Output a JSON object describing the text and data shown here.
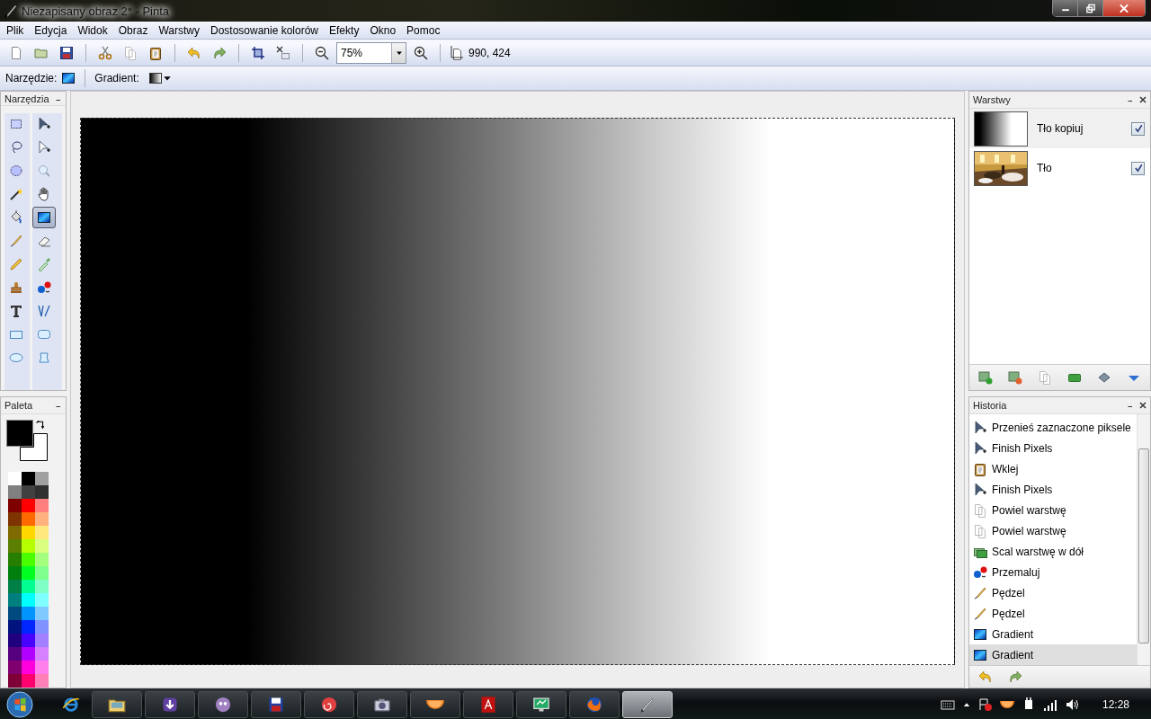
{
  "window": {
    "title": "Niezapisany obraz 2* - Pinta"
  },
  "menu": [
    "Plik",
    "Edycja",
    "Widok",
    "Obraz",
    "Warstwy",
    "Dostosowanie kolorów",
    "Efekty",
    "Okno",
    "Pomoc"
  ],
  "toolbar": {
    "zoom": "75%",
    "coordinates": "990, 424"
  },
  "tool_options": {
    "tool_label": "Narzędzie:",
    "gradient_label": "Gradient:"
  },
  "tools_panel": {
    "title": "Narzędzia",
    "tools": [
      {
        "selected": false
      },
      {
        "selected": false
      },
      {
        "selected": false
      },
      {
        "selected": false
      },
      {
        "selected": false
      },
      {
        "selected": false
      },
      {
        "selected": false
      },
      {
        "selected": false
      },
      {
        "selected": false
      },
      {
        "selected": true
      },
      {
        "selected": false
      },
      {
        "selected": false
      },
      {
        "selected": false
      },
      {
        "selected": false
      },
      {
        "selected": false
      },
      {
        "selected": false
      },
      {
        "selected": false
      },
      {
        "selected": false
      },
      {
        "selected": false
      },
      {
        "selected": false
      },
      {
        "selected": false
      },
      {
        "selected": false
      }
    ]
  },
  "palette_panel": {
    "title": "Paleta",
    "primary": {
      "color": "#000000"
    },
    "secondary": {
      "color": "#ffffff"
    },
    "swatches": [
      {
        "color": "#ffffff"
      },
      {
        "color": "#000000"
      },
      {
        "color": "#a0a0a0"
      },
      {
        "color": "#808080"
      },
      {
        "color": "#404040"
      },
      {
        "color": "#303030"
      },
      {
        "color": "#7f0000"
      },
      {
        "color": "#ff0000"
      },
      {
        "color": "#ff7f7f"
      },
      {
        "color": "#7f3300"
      },
      {
        "color": "#ff6a00"
      },
      {
        "color": "#ffb27f"
      },
      {
        "color": "#7f6a00"
      },
      {
        "color": "#ffd800"
      },
      {
        "color": "#ffe97f"
      },
      {
        "color": "#5b7f00"
      },
      {
        "color": "#b6ff00"
      },
      {
        "color": "#daff7f"
      },
      {
        "color": "#267f00"
      },
      {
        "color": "#4cff00"
      },
      {
        "color": "#a5ff7f"
      },
      {
        "color": "#007f0e"
      },
      {
        "color": "#00ff21"
      },
      {
        "color": "#7fff8e"
      },
      {
        "color": "#007f46"
      },
      {
        "color": "#00ff90"
      },
      {
        "color": "#7fffc5"
      },
      {
        "color": "#007f7f"
      },
      {
        "color": "#00ffff"
      },
      {
        "color": "#7fffff"
      },
      {
        "color": "#004a7f"
      },
      {
        "color": "#0094ff"
      },
      {
        "color": "#7fc9ff"
      },
      {
        "color": "#00137f"
      },
      {
        "color": "#0026ff"
      },
      {
        "color": "#7f92ff"
      },
      {
        "color": "#21007f"
      },
      {
        "color": "#4800ff"
      },
      {
        "color": "#a17fff"
      },
      {
        "color": "#57007f"
      },
      {
        "color": "#b200ff"
      },
      {
        "color": "#d67fff"
      },
      {
        "color": "#7f006e"
      },
      {
        "color": "#ff00dc"
      },
      {
        "color": "#ff7fed"
      },
      {
        "color": "#7f0037"
      },
      {
        "color": "#ff006e"
      },
      {
        "color": "#ff7fb6"
      }
    ]
  },
  "layers_panel": {
    "title": "Warstwy",
    "layers": [
      {
        "name": "Tło kopiuj",
        "visible": true,
        "selected": true,
        "kind": "gradient"
      },
      {
        "name": "Tło",
        "visible": true,
        "selected": false,
        "kind": "picture"
      }
    ]
  },
  "history_panel": {
    "title": "Historia",
    "items": [
      {
        "label": "Przenieś zaznaczone piksele",
        "kind": "move",
        "selected": false
      },
      {
        "label": "Finish Pixels",
        "kind": "move",
        "selected": false
      },
      {
        "label": "Wklej",
        "kind": "paste",
        "selected": false
      },
      {
        "label": "Finish Pixels",
        "kind": "move",
        "selected": false
      },
      {
        "label": "Powiel warstwę",
        "kind": "duplicate",
        "selected": false
      },
      {
        "label": "Powiel warstwę",
        "kind": "duplicate",
        "selected": false
      },
      {
        "label": "Scal warstwę w dół",
        "kind": "merge",
        "selected": false
      },
      {
        "label": "Przemaluj",
        "kind": "recolor",
        "selected": false
      },
      {
        "label": "Pędzel",
        "kind": "brush",
        "selected": false
      },
      {
        "label": "Pędzel",
        "kind": "brush",
        "selected": false
      },
      {
        "label": "Gradient",
        "kind": "gradient",
        "selected": false
      },
      {
        "label": "Gradient",
        "kind": "gradient",
        "selected": true
      }
    ]
  },
  "taskbar": {
    "apps": [
      {
        "selected": false
      },
      {
        "selected": false
      },
      {
        "selected": false
      },
      {
        "selected": false
      },
      {
        "selected": false
      },
      {
        "selected": false
      },
      {
        "selected": false
      },
      {
        "selected": false
      },
      {
        "selected": false
      },
      {
        "selected": false
      },
      {
        "selected": false
      },
      {
        "selected": true
      }
    ],
    "clock": "12:28"
  }
}
